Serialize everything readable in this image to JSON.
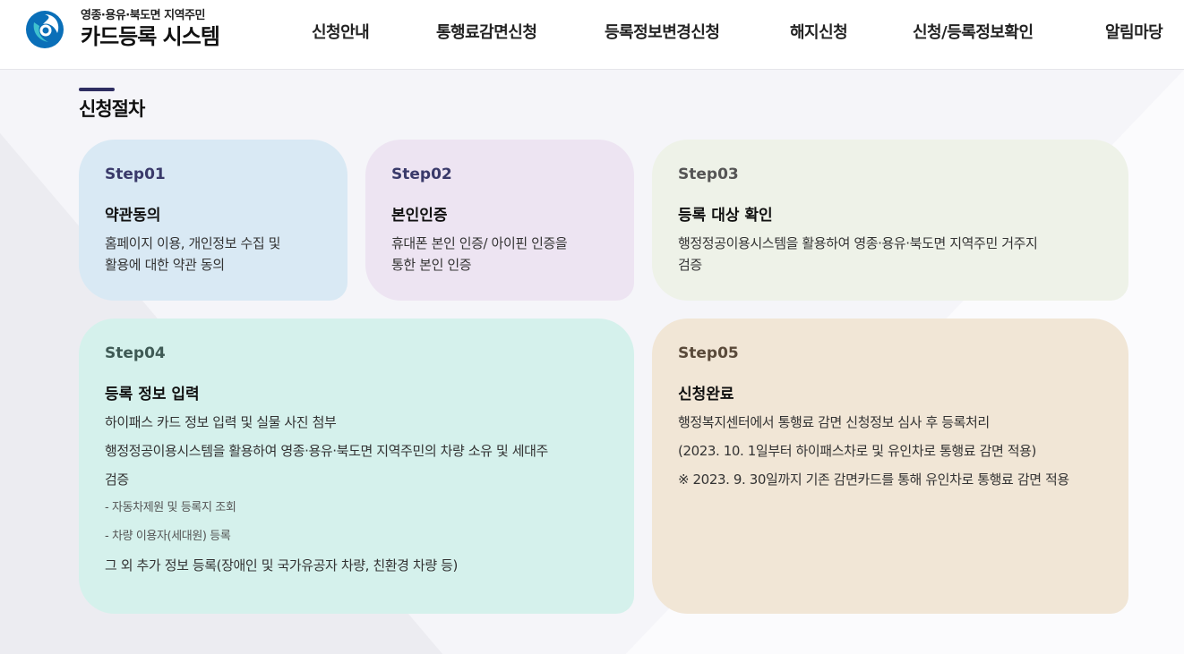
{
  "header": {
    "logo_sub": "영종·용유·북도면 지역주민",
    "logo_main": "카드등록 시스템",
    "nav": [
      {
        "label": "신청안내"
      },
      {
        "label": "통행료감면신청"
      },
      {
        "label": "등록정보변경신청"
      },
      {
        "label": "해지신청"
      },
      {
        "label": "신청/등록정보확인"
      },
      {
        "label": "알림마당"
      }
    ]
  },
  "section": {
    "title": "신청절차"
  },
  "steps": [
    {
      "step": "Step01",
      "title": "약관동의",
      "desc_lines": [
        "홈페이지 이용, 개인정보 수집 및",
        "활용에 대한 약관 동의"
      ]
    },
    {
      "step": "Step02",
      "title": "본인인증",
      "desc_lines": [
        "휴대폰 본인 인증/ 아이핀 인증을",
        "통한 본인 인증"
      ]
    },
    {
      "step": "Step03",
      "title": "등록 대상 확인",
      "desc_lines": [
        "행정정공이용시스템을 활용하여 영종·용유·북도면 지역주민 거주지",
        "검증"
      ]
    },
    {
      "step": "Step04",
      "title": "등록 정보 입력",
      "lines": [
        "하이패스 카드 정보 입력 및 실물 사진 첨부",
        "행정정공이용시스템을 활용하여 영종·용유·북도면 지역주민의 차량 소유 및 세대주",
        "검증"
      ],
      "sub_lines": [
        "- 자동차제원 및 등록지 조회",
        "- 차량 이용자(세대원) 등록"
      ],
      "last_line": "그 외 추가 정보 등록(장애인 및 국가유공자 차량, 친환경 차량 등)"
    },
    {
      "step": "Step05",
      "title": "신청완료",
      "lines": [
        "행정복지센터에서 통행료 감면 신청정보 심사 후 등록처리",
        "(2023. 10. 1일부터 하이패스차로 및 유인차로 통행료 감면 적용)",
        "※ 2023. 9. 30일까지 기존 감면카드를 통해 유인차로 통행료 감면 적용"
      ]
    }
  ],
  "colors": {
    "accent": "#2f2e62",
    "logo_blue": "#0a6fb8",
    "logo_teal": "#1aa3b8"
  }
}
